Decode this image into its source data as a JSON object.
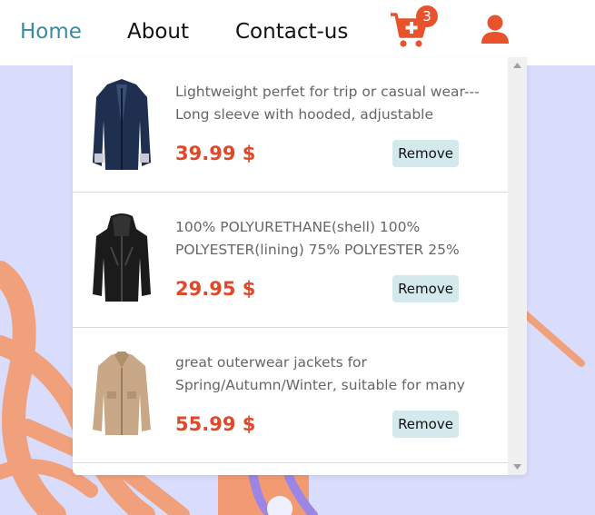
{
  "nav": {
    "links": [
      {
        "label": "Home",
        "active": true
      },
      {
        "label": "About",
        "active": false
      },
      {
        "label": "Contact-us",
        "active": false
      }
    ],
    "cart_count": "3",
    "cart_icon": "cart-plus-icon",
    "user_icon": "user-icon"
  },
  "colors": {
    "accent": "#e8532e",
    "active_link": "#3b8aa0",
    "remove_bg": "#d3e9ec",
    "price": "#e0482a"
  },
  "cart_items": [
    {
      "description": "Lightweight perfet for trip or casual wear---Long sleeve with hooded, adjustable",
      "price": "39.99 $",
      "remove_label": "Remove",
      "image": "navy-jacket-image"
    },
    {
      "description": "100% POLYURETHANE(shell) 100% POLYESTER(lining) 75% POLYESTER 25%",
      "price": "29.95 $",
      "remove_label": "Remove",
      "image": "black-leather-jacket-image"
    },
    {
      "description": "great outerwear jackets for Spring/Autumn/Winter, suitable for many",
      "price": "55.99 $",
      "remove_label": "Remove",
      "image": "khaki-jacket-image"
    }
  ]
}
